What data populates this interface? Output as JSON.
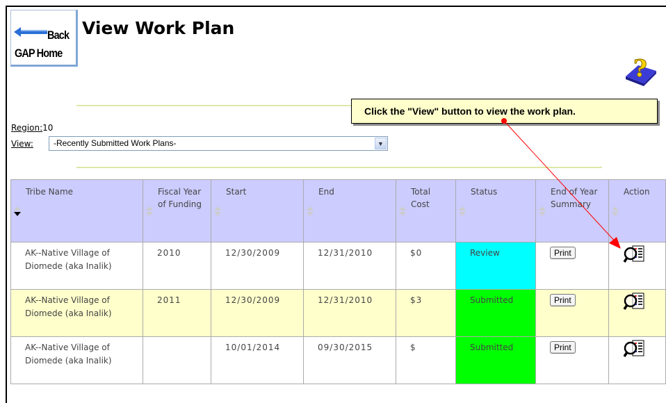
{
  "header": {
    "back_label": "Back",
    "home_label": "GAP Home",
    "title": "View Work Plan"
  },
  "callout": {
    "text": "Click the \"View\" button to view the work plan."
  },
  "filters": {
    "region_label": "Region:",
    "region_value": "10",
    "view_label": "View:",
    "view_selected": "-Recently Submitted Work Plans-"
  },
  "table": {
    "columns": [
      "Tribe Name",
      "Fiscal Year of Funding",
      "Start",
      "End",
      "Total Cost",
      "Status",
      "End of Year Summary",
      "Action"
    ],
    "rows": [
      {
        "tribe": "AK--Native Village of Diomede (aka Inalik)",
        "fiscal_year": "2010",
        "start": "12/30/2009",
        "end": "12/31/2010",
        "cost": "$0",
        "status": "Review",
        "summary": "Print"
      },
      {
        "tribe": "AK--Native Village of Diomede (aka Inalik)",
        "fiscal_year": "2011",
        "start": "12/30/2009",
        "end": "12/31/2010",
        "cost": "$3",
        "status": "Submitted",
        "summary": "Print"
      },
      {
        "tribe": "AK--Native Village of Diomede (aka Inalik)",
        "fiscal_year": "",
        "start": "10/01/2014",
        "end": "09/30/2015",
        "cost": "$",
        "status": "Submitted",
        "summary": "Print"
      }
    ]
  },
  "colors": {
    "header_bg": "#ccccff",
    "alt_row_bg": "#ffffcc",
    "status_review": "#00ffff",
    "status_submitted": "#00ff00",
    "annotation_arrow": "#ff0000"
  },
  "icons": [
    "back-arrow-icon",
    "help-book-icon",
    "view-magnifier-icon",
    "sort-icon"
  ]
}
